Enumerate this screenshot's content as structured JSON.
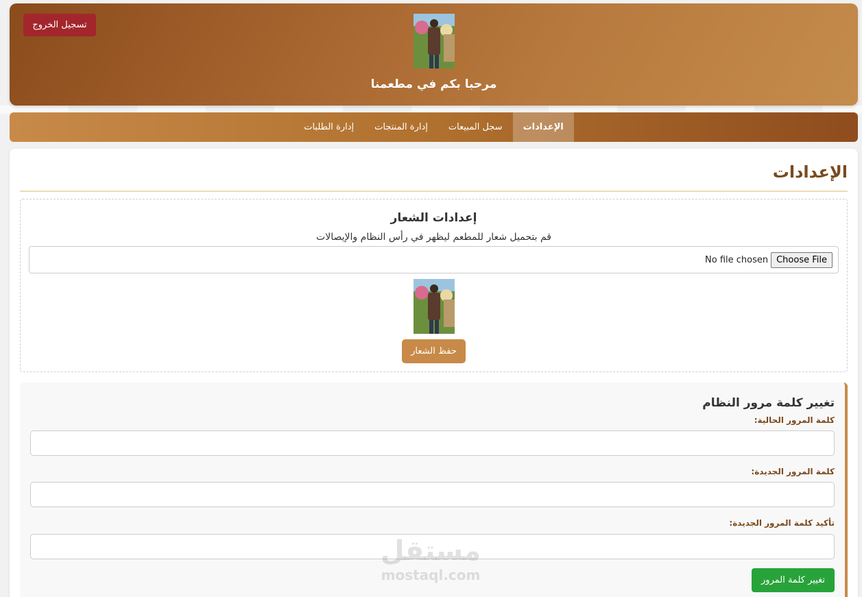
{
  "header": {
    "logout_label": "تسجيل الخروج",
    "welcome_title": "مرحبا بكم في مطعمنا"
  },
  "nav": {
    "items": [
      {
        "label": "الإعدادات",
        "active": true
      },
      {
        "label": "سجل المبيعات",
        "active": false
      },
      {
        "label": "إدارة المنتجات",
        "active": false
      },
      {
        "label": "إدارة الطلبات",
        "active": false
      }
    ]
  },
  "page": {
    "title": "الإعدادات"
  },
  "logo_settings": {
    "heading": "إعدادات الشعار",
    "description": "قم بتحميل شعار للمطعم ليظهر في رأس النظام والإيصالات",
    "choose_file_label": "Choose File",
    "no_file_text": "No file chosen",
    "save_label": "حفظ الشعار"
  },
  "password_settings": {
    "heading": "تغيير كلمة مرور النظام",
    "current_label": "كلمة المرور الحالية:",
    "new_label": "كلمة المرور الجديدة:",
    "confirm_label": "تأكيد كلمة المرور الجديدة:",
    "current_value": "",
    "new_value": "",
    "confirm_value": "",
    "submit_label": "تغيير كلمة المرور"
  },
  "watermark": {
    "arabic": "مستقل",
    "latin": "mostaql.com"
  },
  "colors": {
    "brand_brown": "#8b4b1c",
    "accent_tan": "#c88a48",
    "logout_red": "#a3262c",
    "submit_green": "#28a33a"
  }
}
